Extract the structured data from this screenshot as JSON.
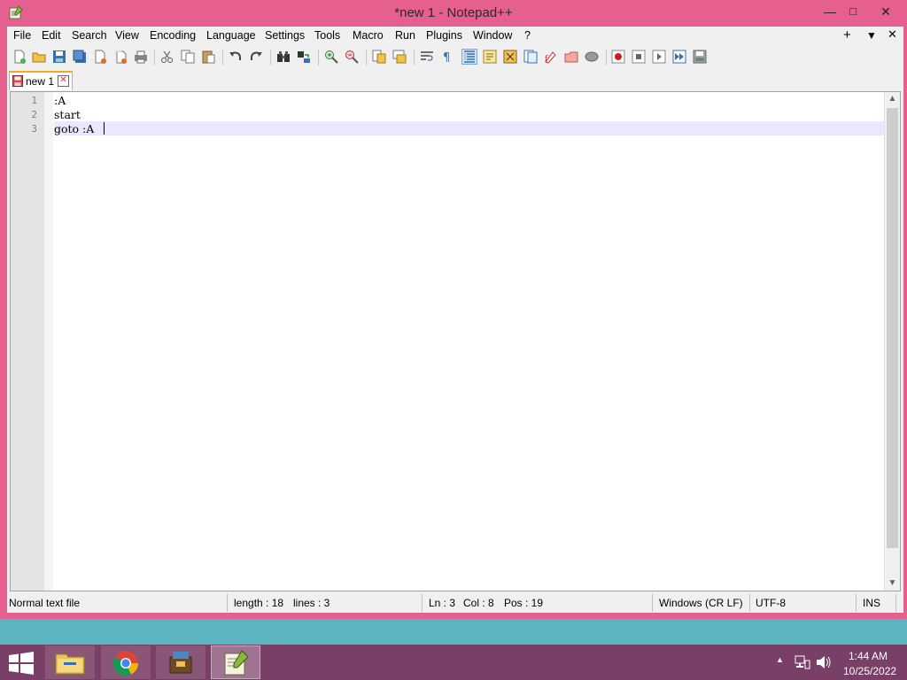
{
  "window": {
    "title": "*new 1 - Notepad++",
    "controls": {
      "minimize": "—",
      "maximize": "□",
      "close": "✕"
    }
  },
  "menu": {
    "items": [
      "File",
      "Edit",
      "Search",
      "View",
      "Encoding",
      "Language",
      "Settings",
      "Tools",
      "Macro",
      "Run",
      "Plugins",
      "Window",
      "?"
    ],
    "right": {
      "add": "+",
      "dropdown": "▼",
      "close": "✕"
    }
  },
  "tab": {
    "label": "new 1",
    "close": "✕"
  },
  "editor": {
    "line_numbers": [
      "1",
      "2",
      "3"
    ],
    "lines": [
      ":A",
      "start",
      "goto :A"
    ],
    "current_line": 3
  },
  "scrollbar": {
    "up": "▲",
    "down": "▼"
  },
  "status": {
    "filetype": "Normal text file",
    "length": "length : 18",
    "lines": "lines : 3",
    "ln": "Ln : 3",
    "col": "Col : 8",
    "pos": "Pos : 19",
    "eol": "Windows (CR LF)",
    "encoding": "UTF-8",
    "mode": "INS"
  },
  "taskbar": {
    "time": "1:44 AM",
    "date": "10/25/2022",
    "tray_arrow": "▲"
  },
  "colors": {
    "window_frame": "#e5608e",
    "taskbar": "#7a3f66",
    "current_line": "#e8e8ff",
    "desktop": "#5bb4c0"
  }
}
